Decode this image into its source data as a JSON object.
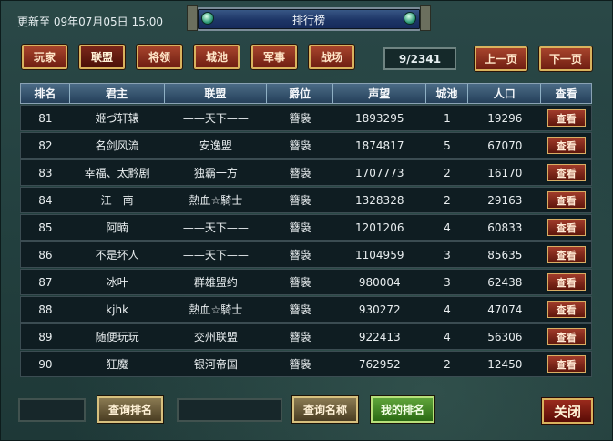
{
  "header": {
    "updated_label": "更新至 09年07月05日 15:00",
    "window_title": "排行榜"
  },
  "tabs": [
    {
      "label": "玩家"
    },
    {
      "label": "联盟"
    },
    {
      "label": "将领"
    },
    {
      "label": "城池"
    },
    {
      "label": "军事"
    },
    {
      "label": "战场"
    }
  ],
  "pagination": {
    "page_text": "9/2341",
    "prev_label": "上一页",
    "next_label": "下一页"
  },
  "table": {
    "columns": [
      "排名",
      "君主",
      "联盟",
      "爵位",
      "声望",
      "城池",
      "人口",
      "查看"
    ],
    "view_label": "查看",
    "rows": [
      {
        "rank": "81",
        "lord": "姬づ轩辕",
        "alliance": "——天下——",
        "title": "簪袅",
        "prestige": "1893295",
        "cities": "1",
        "population": "19296"
      },
      {
        "rank": "82",
        "lord": "名剑风流",
        "alliance": "安逸盟",
        "title": "簪袅",
        "prestige": "1874817",
        "cities": "5",
        "population": "67070"
      },
      {
        "rank": "83",
        "lord": "幸福、太黔剧",
        "alliance": "独霸一方",
        "title": "簪袅",
        "prestige": "1707773",
        "cities": "2",
        "population": "16170"
      },
      {
        "rank": "84",
        "lord": "江　南",
        "alliance": "熱血☆騎士",
        "title": "簪袅",
        "prestige": "1328328",
        "cities": "2",
        "population": "29163"
      },
      {
        "rank": "85",
        "lord": "阿暔",
        "alliance": "——天下——",
        "title": "簪袅",
        "prestige": "1201206",
        "cities": "4",
        "population": "60833"
      },
      {
        "rank": "86",
        "lord": "不是坏人",
        "alliance": "——天下——",
        "title": "簪袅",
        "prestige": "1104959",
        "cities": "3",
        "population": "85635"
      },
      {
        "rank": "87",
        "lord": "冰叶",
        "alliance": "群雄盟约",
        "title": "簪袅",
        "prestige": "980004",
        "cities": "3",
        "population": "62438"
      },
      {
        "rank": "88",
        "lord": "kjhk",
        "alliance": "熱血☆騎士",
        "title": "簪袅",
        "prestige": "930272",
        "cities": "4",
        "population": "47074"
      },
      {
        "rank": "89",
        "lord": "随便玩玩",
        "alliance": "交州联盟",
        "title": "簪袅",
        "prestige": "922413",
        "cities": "4",
        "population": "56306"
      },
      {
        "rank": "90",
        "lord": "狂魔",
        "alliance": "银河帝国",
        "title": "簪袅",
        "prestige": "762952",
        "cities": "2",
        "population": "12450"
      }
    ]
  },
  "footer": {
    "rank_query_value": "",
    "rank_query_button": "查询排名",
    "name_query_value": "",
    "name_query_button": "查询名称",
    "my_rank_button": "我的排名",
    "close_button": "关闭"
  }
}
